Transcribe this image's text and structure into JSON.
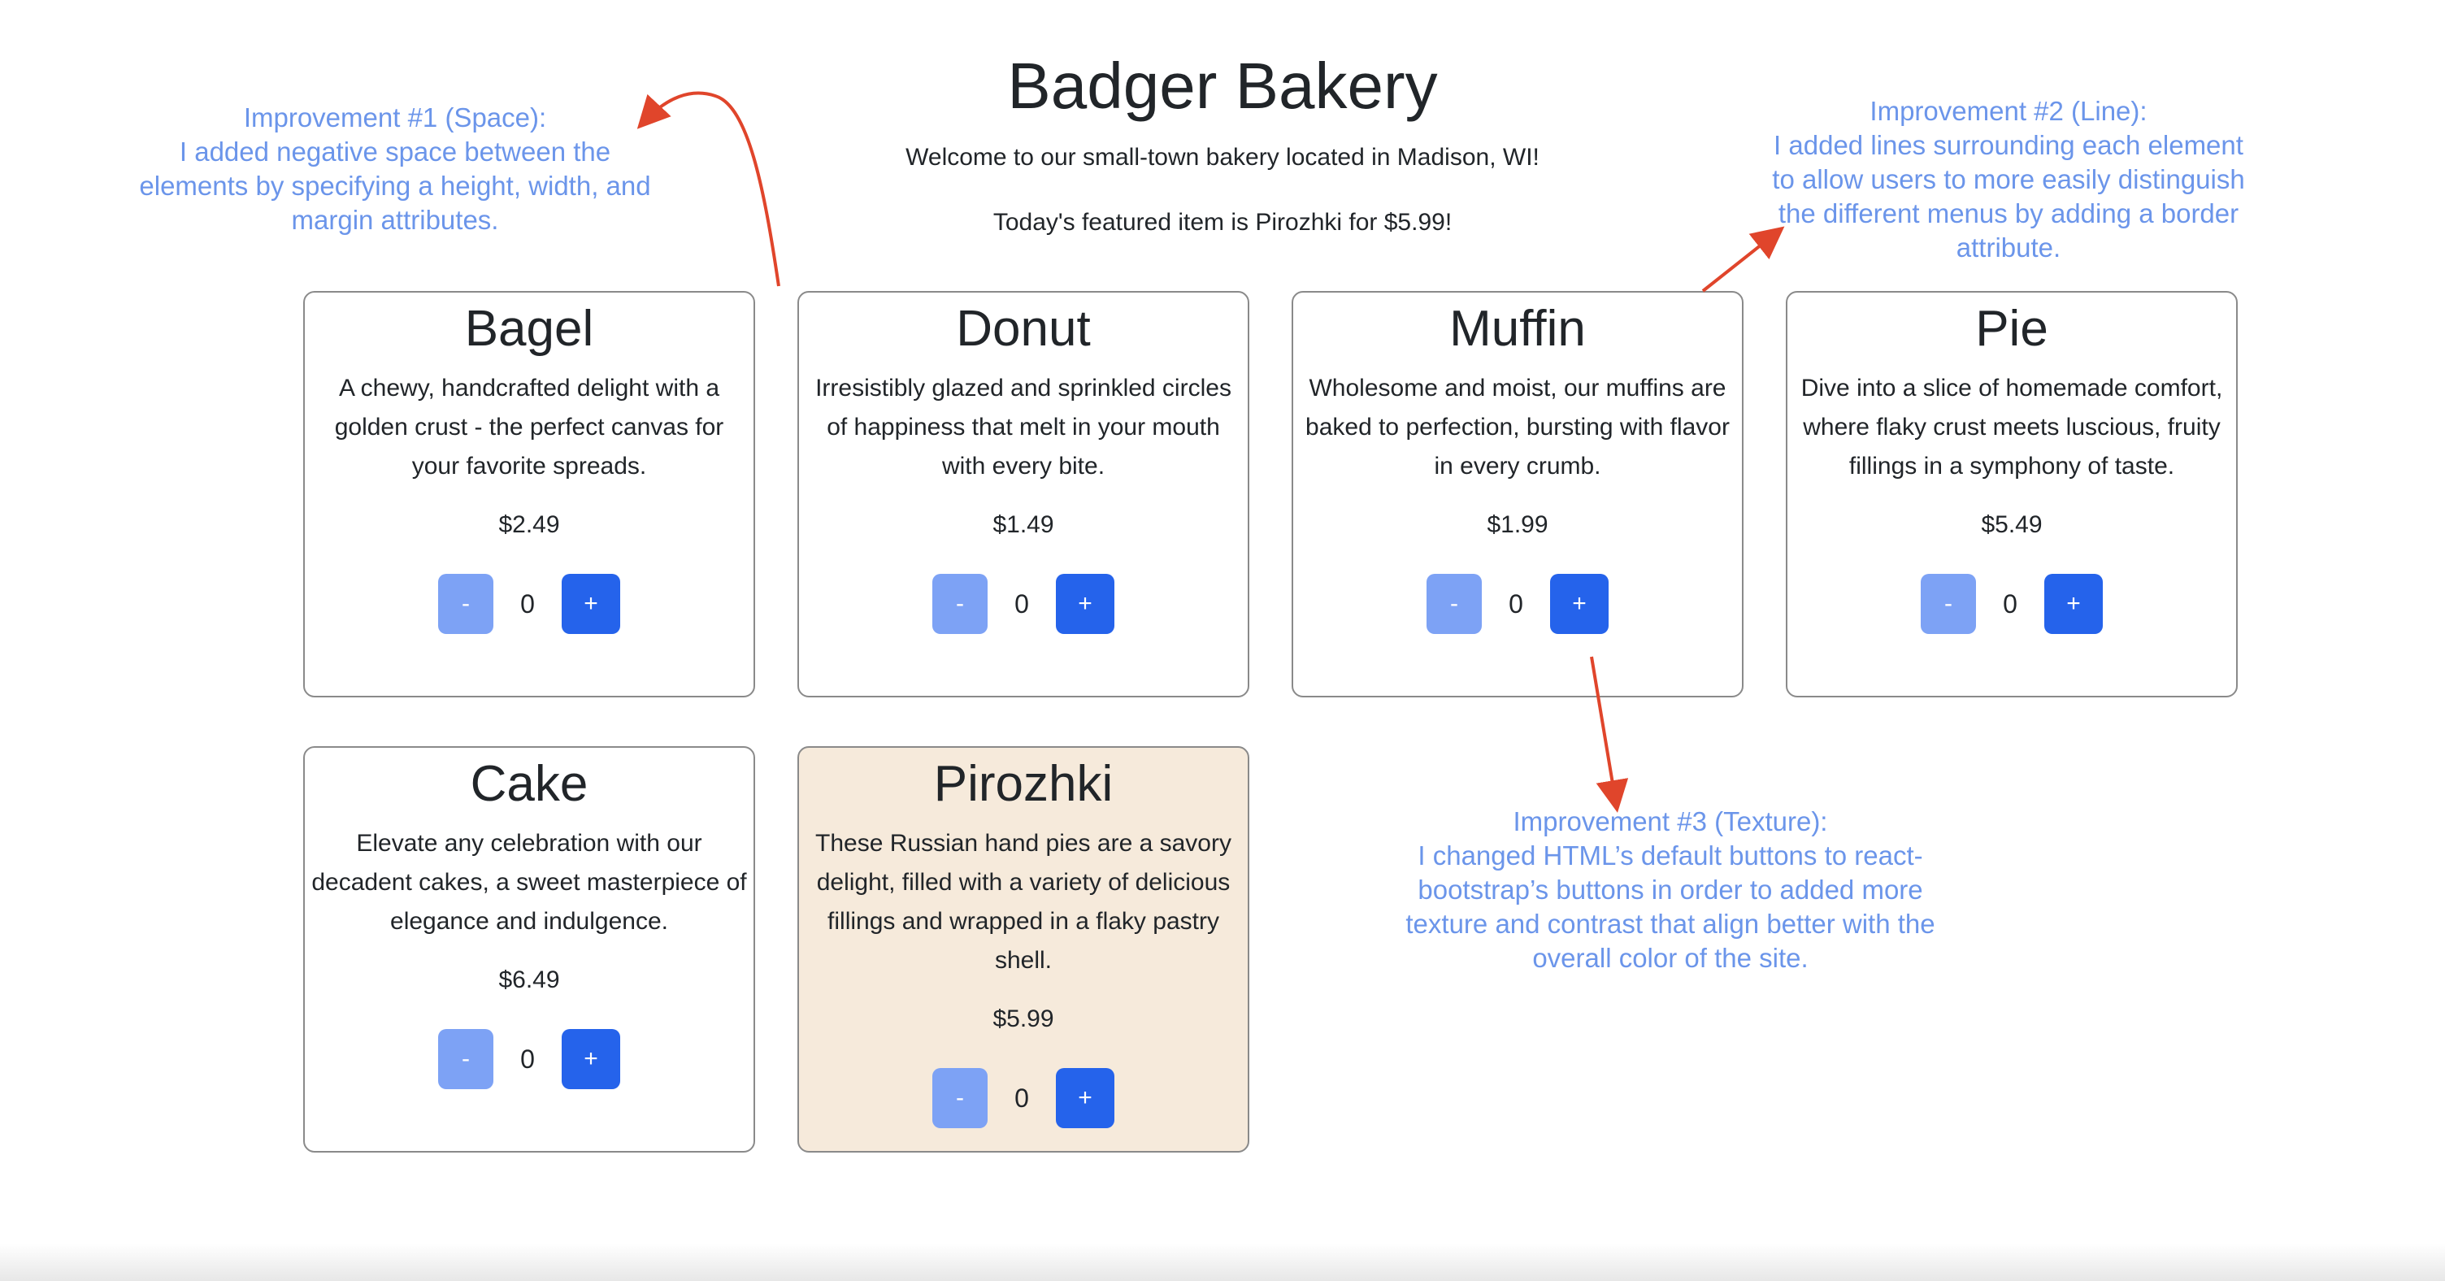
{
  "header": {
    "title": "Badger Bakery",
    "welcome": "Welcome to our small-town bakery located in Madison, WI!",
    "featured": "Today's featured item is Pirozhki for $5.99!"
  },
  "items": [
    {
      "name": "Bagel",
      "description": "A chewy, handcrafted delight with a golden crust - the perfect canvas for your favorite spreads.",
      "price": "$2.49",
      "quantity": "0",
      "featured": false
    },
    {
      "name": "Donut",
      "description": "Irresistibly glazed and sprinkled circles of happiness that melt in your mouth with every bite.",
      "price": "$1.49",
      "quantity": "0",
      "featured": false
    },
    {
      "name": "Muffin",
      "description": "Wholesome and moist, our muffins are baked to perfection, bursting with flavor in every crumb.",
      "price": "$1.99",
      "quantity": "0",
      "featured": false
    },
    {
      "name": "Pie",
      "description": "Dive into a slice of homemade comfort, where flaky crust meets luscious, fruity fillings in a symphony of taste.",
      "price": "$5.49",
      "quantity": "0",
      "featured": false
    },
    {
      "name": "Cake",
      "description": "Elevate any celebration with our decadent cakes, a sweet masterpiece of elegance and indulgence.",
      "price": "$6.49",
      "quantity": "0",
      "featured": false
    },
    {
      "name": "Pirozhki",
      "description": "These Russian hand pies are a savory delight, filled with a variety of delicious fillings and wrapped in a flaky pastry shell.",
      "price": "$5.99",
      "quantity": "0",
      "featured": true
    }
  ],
  "buttons": {
    "minus": "-",
    "plus": "+"
  },
  "annotations": {
    "space": {
      "title": "Improvement #1 (Space):",
      "body": "I added negative space between the elements by specifying a height, width, and margin attributes."
    },
    "line": {
      "title": "Improvement #2 (Line):",
      "body": "I added lines surrounding each element to allow users to more easily distinguish the different menus by adding a border attribute."
    },
    "texture": {
      "title": "Improvement #3 (Texture):",
      "body": "I changed HTML’s default buttons to react-bootstrap’s buttons in order to added more texture and contrast that align better with the overall color of the site."
    }
  },
  "colors": {
    "annotation_text": "#6b95ea",
    "arrow": "#e0452b",
    "button_primary": "#2563eb",
    "button_light": "#7da2f5",
    "featured_card_bg": "#f6eadb"
  }
}
